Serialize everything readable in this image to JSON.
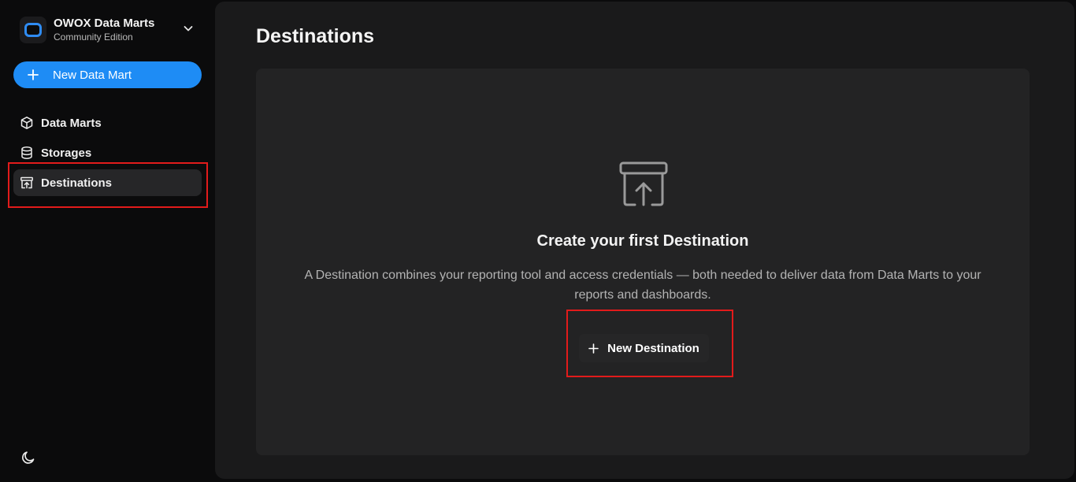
{
  "app": {
    "name": "OWOX Data Marts",
    "edition": "Community Edition"
  },
  "sidebar": {
    "new_button_label": "New Data Mart",
    "items": [
      {
        "label": "Data Marts",
        "icon": "cube-icon",
        "active": false
      },
      {
        "label": "Storages",
        "icon": "database-icon",
        "active": false
      },
      {
        "label": "Destinations",
        "icon": "archive-upload-icon",
        "active": true
      }
    ],
    "theme_icon": "moon-icon"
  },
  "main": {
    "title": "Destinations",
    "empty_state": {
      "icon": "archive-upload-icon",
      "title": "Create your first Destination",
      "description": "A Destination combines your reporting tool and access credentials — both needed to deliver data from Data Marts to your reports and dashboards.",
      "button_label": "New Destination"
    }
  },
  "colors": {
    "accent": "#1e8cf5",
    "highlight": "#e21b1b",
    "background": "#0b0b0c",
    "panel": "#1a1a1b",
    "card": "#232324"
  }
}
